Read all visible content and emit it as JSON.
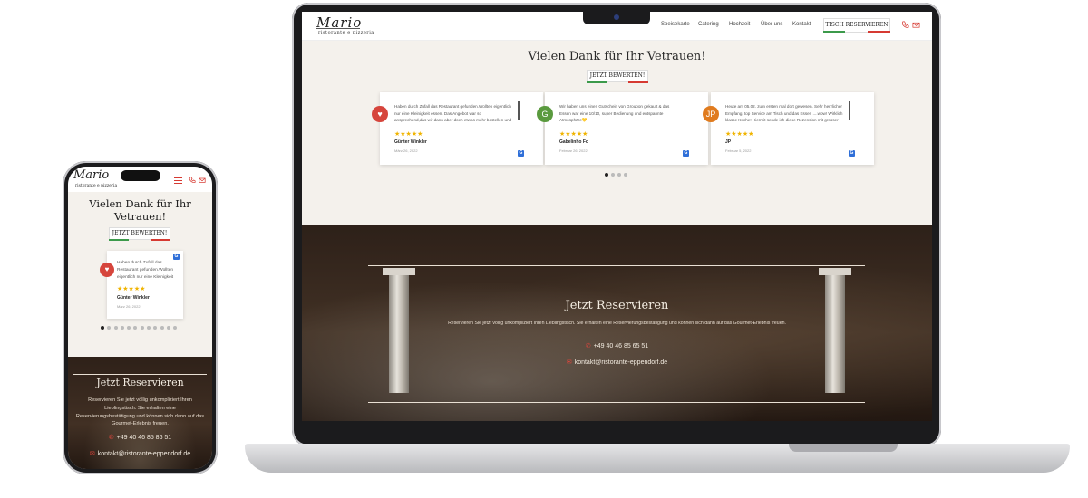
{
  "desktop": {
    "brand": {
      "name": "Mario",
      "tagline": "ristorante e pizzeria"
    },
    "nav": {
      "items": [
        "Speisekarte",
        "Catering",
        "Hochzeit",
        "Über uns",
        "Kontakt"
      ],
      "cta": "TISCH RESERVIEREN"
    },
    "reviews": {
      "title": "Vielen Dank für Ihr Vetrauen!",
      "button": "JETZT BEWERTEN!",
      "cards": [
        {
          "initial": "♥",
          "avatar_color": "#d6453c",
          "text": "Haben durch Zufall das Restaurant gefunden.Wollten eigentlich nur eine Kleinigkeit essen. Das Angebot war so ansprechend,das wir dann aber doch etwas mehr bestellen und es nicht bereut",
          "stars": "★★★★★",
          "name": "Günter Winkler",
          "date": "März 26, 2022"
        },
        {
          "initial": "G",
          "avatar_color": "#5a9a3e",
          "text": "Wir haben uns einen Gutschein von Groupon gekauft & das Essen war eine 10/10, super Bedienung und entspannte Atmosphäre💛",
          "stars": "★★★★★",
          "name": "Gabelinho Fc",
          "date": "Februar 26, 2022"
        },
        {
          "initial": "JP",
          "avatar_color": "#e07b1e",
          "text": "Heute am 05.02. zum ersten mal dort gewesen. Sehr herzlicher Empfang, top Service am Tisch und das Essen ....wow! Wirklich klasse Küche! Hiermit sende ich diese Rezension mit grosser",
          "stars": "★★★★★",
          "name": "JP",
          "date": "Februar 5, 2022"
        }
      ]
    },
    "reservation": {
      "title": "Jetzt Reservieren",
      "desc": "Reservieren Sie jetzt völlig unkompliziert Ihren Lieblingstisch. Sie erhalten eine Reservierungsbestätigung und können sich dann auf das Gourmet-Erlebnis freuen.",
      "phone": "+49 40 46 85 65 51",
      "email": "kontakt@ristorante-eppendorf.de"
    }
  },
  "mobile": {
    "brand": {
      "name": "Mario",
      "tagline": "ristorante e pizzeria"
    },
    "reviews": {
      "title_line1": "Vielen Dank für Ihr",
      "title_line2": "Vetrauen!",
      "button": "JETZT BEWERTEN!",
      "card": {
        "text": "Haben durch Zufall das Restaurant gefunden.Wollten eigentlich nur eine Kleinigkeit",
        "stars": "★★★★★",
        "name": "Günter Winkler",
        "date": "März 26, 2022"
      }
    },
    "reservation": {
      "title": "Jetzt Reservieren",
      "desc": "Reservieren Sie jetzt völlig unkompliziert Ihren Lieblingstisch. Sie erhalten eine Reservierungsbestätigung und können sich dann auf das Gourmet-Erlebnis freuen.",
      "phone": "+49 40 46 85 86 51",
      "email": "kontakt@ristorante-eppendorf.de"
    }
  },
  "icons": {
    "phone": "phone-icon",
    "mail": "mail-icon",
    "menu": "hamburger-menu-icon",
    "google": "google-icon"
  },
  "colors": {
    "accent_red": "#d63a32",
    "flag_green": "#3c9a4b",
    "flag_red": "#d63a32",
    "star": "#f0b400",
    "background": "#f4f1ec"
  }
}
